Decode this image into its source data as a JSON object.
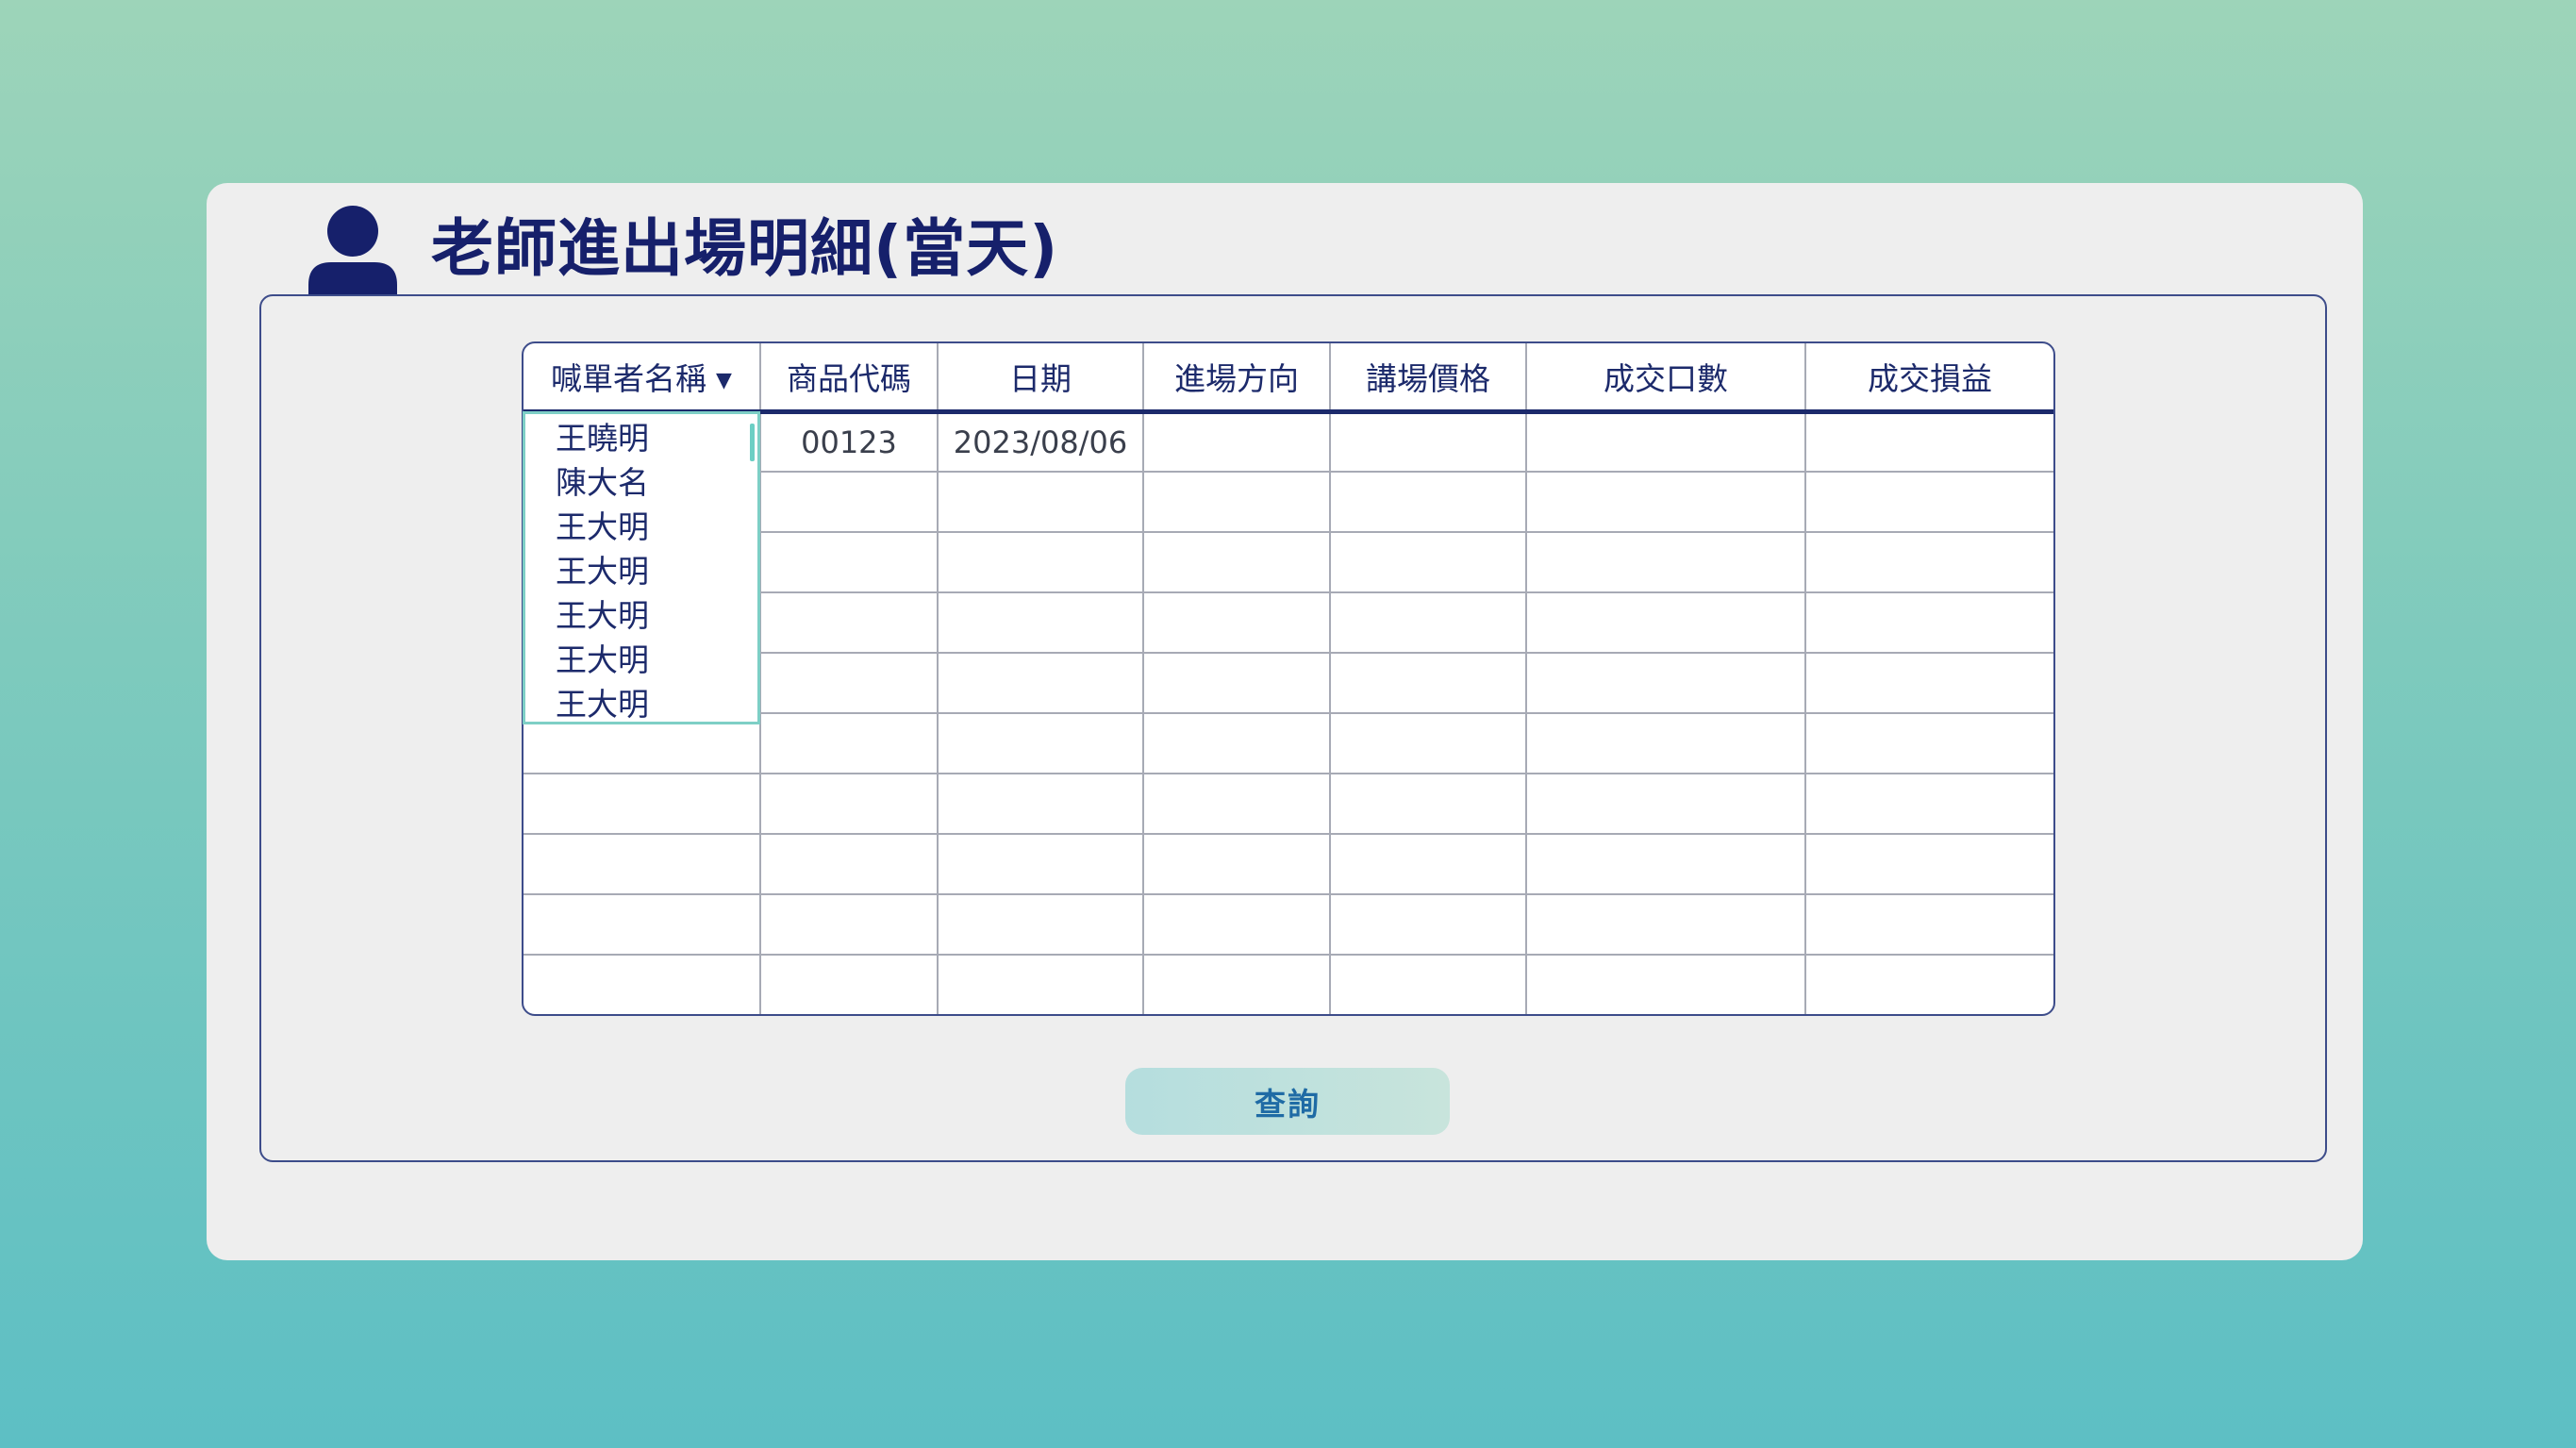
{
  "page_title": "老師進出場明細(當天)",
  "icons": {
    "header": "user-icon",
    "dropdown_caret": "caret-down-icon"
  },
  "colors": {
    "title": "#16206b",
    "accent": "#1c2a6b",
    "dropdown_border": "#7ecfc6",
    "button_text": "#1f6ba5"
  },
  "table": {
    "columns": [
      "喊單者名稱",
      "商品代碼",
      "日期",
      "進場方向",
      "講場價格",
      "成交口數",
      "成交損益"
    ],
    "rows": [
      [
        "",
        "00123",
        "2023/08/06",
        "",
        "",
        "",
        ""
      ],
      [
        "",
        "",
        "",
        "",
        "",
        "",
        ""
      ],
      [
        "",
        "",
        "",
        "",
        "",
        "",
        ""
      ],
      [
        "",
        "",
        "",
        "",
        "",
        "",
        ""
      ],
      [
        "",
        "",
        "",
        "",
        "",
        "",
        ""
      ],
      [
        "",
        "",
        "",
        "",
        "",
        "",
        ""
      ],
      [
        "",
        "",
        "",
        "",
        "",
        "",
        ""
      ],
      [
        "",
        "",
        "",
        "",
        "",
        "",
        ""
      ],
      [
        "",
        "",
        "",
        "",
        "",
        "",
        ""
      ],
      [
        "",
        "",
        "",
        "",
        "",
        "",
        ""
      ]
    ]
  },
  "caller_dropdown": {
    "caret": "▼",
    "options": [
      "王曉明",
      "陳大名",
      "王大明",
      "王大明",
      "王大明",
      "王大明",
      "王大明"
    ]
  },
  "query_button": {
    "label": "查詢"
  }
}
